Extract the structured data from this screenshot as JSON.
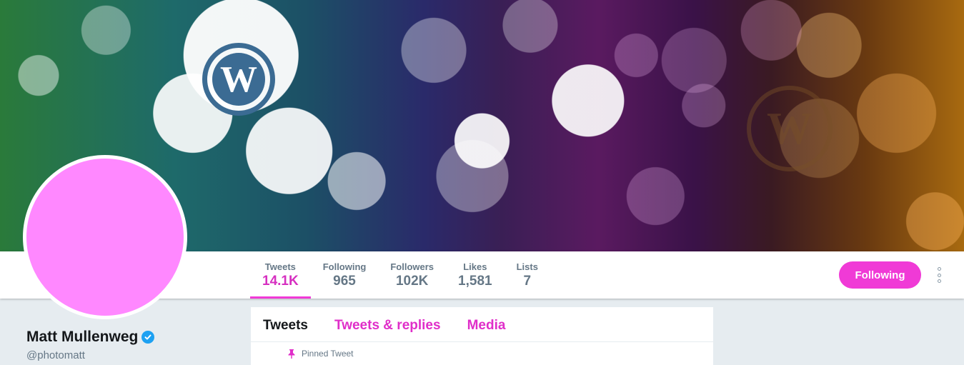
{
  "banner": {
    "logo_glyph": "W",
    "accent_colors": [
      "#2a7a3a",
      "#1e6a6a",
      "#3a1f55",
      "#5a1a60",
      "#a86a10"
    ]
  },
  "profile": {
    "name": "Matt Mullenweg",
    "handle": "@photomatt",
    "verified": true,
    "avatar_color": "#ff88ff"
  },
  "stats": [
    {
      "label": "Tweets",
      "value": "14.1K",
      "active": true
    },
    {
      "label": "Following",
      "value": "965",
      "active": false
    },
    {
      "label": "Followers",
      "value": "102K",
      "active": false
    },
    {
      "label": "Likes",
      "value": "1,581",
      "active": false
    },
    {
      "label": "Lists",
      "value": "7",
      "active": false
    }
  ],
  "actions": {
    "follow_label": "Following",
    "more_icon": "more-vertical-icon"
  },
  "timeline": {
    "tabs": [
      {
        "label": "Tweets",
        "active": true
      },
      {
        "label": "Tweets & replies",
        "active": false
      },
      {
        "label": "Media",
        "active": false
      }
    ],
    "pinned_label": "Pinned Tweet"
  },
  "colors": {
    "accent": "#f03ad6",
    "text_secondary": "#657786",
    "background": "#e6ecf0",
    "verified": "#1da1f2"
  }
}
